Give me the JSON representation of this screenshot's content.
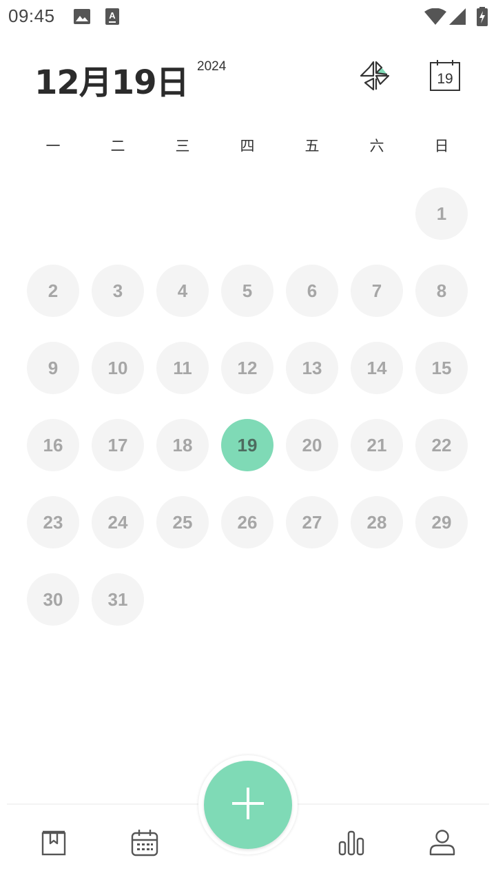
{
  "status_bar": {
    "time": "09:45",
    "icons": [
      "image-icon",
      "keyboard-a-icon",
      "wifi-icon",
      "signal-icon",
      "battery-charging-icon"
    ]
  },
  "header": {
    "date": "12月19日",
    "year": "2024",
    "icons": [
      "pinwheel-icon",
      "calendar-today-icon"
    ],
    "today_icon_day": "19"
  },
  "weekdays": [
    "一",
    "二",
    "三",
    "四",
    "五",
    "六",
    "日"
  ],
  "calendar": {
    "month": 12,
    "year": 2024,
    "first_weekday_index": 6,
    "days": [
      "1",
      "2",
      "3",
      "4",
      "5",
      "6",
      "7",
      "8",
      "9",
      "10",
      "11",
      "12",
      "13",
      "14",
      "15",
      "16",
      "17",
      "18",
      "19",
      "20",
      "21",
      "22",
      "23",
      "24",
      "25",
      "26",
      "27",
      "28",
      "29",
      "30",
      "31"
    ],
    "selected": "19"
  },
  "bottom_nav": {
    "items": [
      "bookmark-book-icon",
      "calendar-icon",
      "add-icon",
      "bar-chart-icon",
      "profile-icon"
    ]
  },
  "colors": {
    "accent": "#7fdab6",
    "day_bg": "#f4f4f4",
    "day_text": "#a6a6a6",
    "selected_text": "#4d6b5f"
  }
}
